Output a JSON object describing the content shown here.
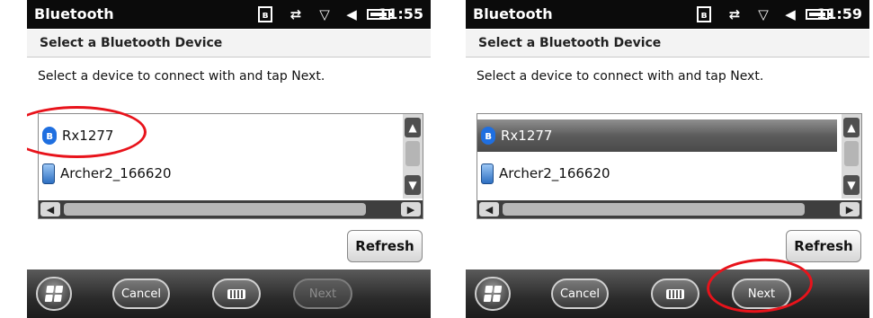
{
  "screens": [
    {
      "status_bar": {
        "title": "Bluetooth",
        "time": "11:55"
      },
      "header": {
        "title": "Select a Bluetooth Device"
      },
      "instructions": "Select a device to connect with and tap Next.",
      "devices": [
        {
          "label": "Rx1277",
          "icon": "bluetooth-icon",
          "selected": false
        },
        {
          "label": "Archer2_166620",
          "icon": "phone-device-icon",
          "selected": false
        }
      ],
      "refresh_label": "Refresh",
      "bottom_bar": {
        "cancel": "Cancel",
        "next": "Next",
        "next_enabled": false
      },
      "annotation": "circle around Rx1277"
    },
    {
      "status_bar": {
        "title": "Bluetooth",
        "time": "11:59"
      },
      "header": {
        "title": "Select a Bluetooth Device"
      },
      "instructions": "Select a device to connect with and tap Next.",
      "devices": [
        {
          "label": "Rx1277",
          "icon": "bluetooth-icon",
          "selected": true
        },
        {
          "label": "Archer2_166620",
          "icon": "phone-device-icon",
          "selected": false
        }
      ],
      "refresh_label": "Refresh",
      "bottom_bar": {
        "cancel": "Cancel",
        "next": "Next",
        "next_enabled": true
      },
      "annotation": "circle around Next"
    }
  ],
  "colors": {
    "annotation": "#e8131b",
    "selection": "#5c5c5c",
    "bluetooth": "#1f6fe0"
  }
}
